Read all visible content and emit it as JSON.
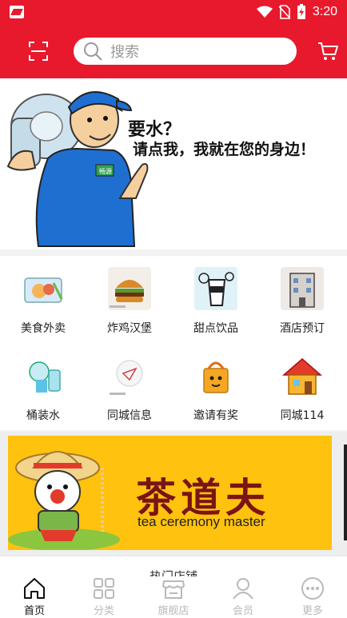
{
  "status_bar": {
    "time": "3:20"
  },
  "search": {
    "placeholder": "搜索"
  },
  "hero": {
    "line1": "要水？",
    "line2": "请点我，我就在您的身边！",
    "bottle_label": "畅源"
  },
  "categories": [
    {
      "label": "美食外卖",
      "icon": "food-delivery-icon"
    },
    {
      "label": "炸鸡汉堡",
      "icon": "burger-icon"
    },
    {
      "label": "甜点饮品",
      "icon": "dessert-drink-icon"
    },
    {
      "label": "酒店预订",
      "icon": "hotel-icon"
    },
    {
      "label": "桶装水",
      "icon": "water-bottle-icon"
    },
    {
      "label": "同城信息",
      "icon": "city-info-icon"
    },
    {
      "label": "邀请有奖",
      "icon": "gift-icon"
    },
    {
      "label": "同城114",
      "icon": "house-icon"
    }
  ],
  "promo": {
    "brand_cn": "茶道夫",
    "brand_en": "tea ceremony master"
  },
  "section_peek": "热门店铺",
  "tabs": [
    {
      "label": "首页",
      "icon": "home-icon",
      "active": true
    },
    {
      "label": "分类",
      "icon": "category-icon",
      "active": false
    },
    {
      "label": "旗舰店",
      "icon": "store-icon",
      "active": false
    },
    {
      "label": "会员",
      "icon": "member-icon",
      "active": false
    },
    {
      "label": "更多",
      "icon": "more-icon",
      "active": false
    }
  ],
  "colors": {
    "brand_red": "#e8192c",
    "promo_yellow": "#ffc20e",
    "worker_blue": "#1f6fd1"
  }
}
